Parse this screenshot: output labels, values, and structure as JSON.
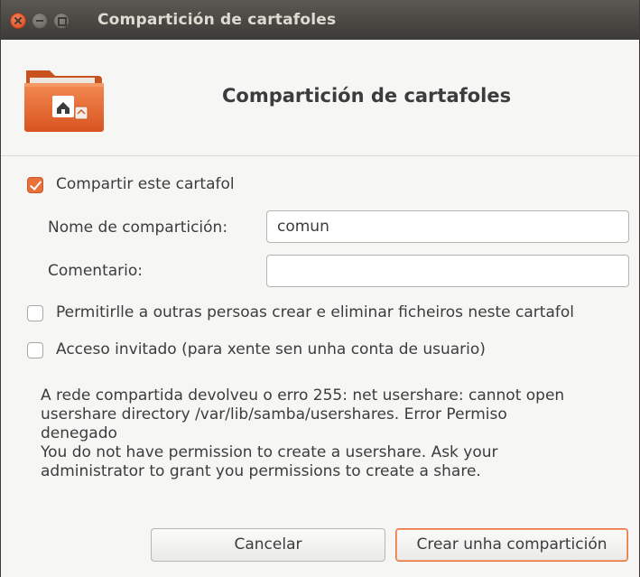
{
  "window": {
    "title": "Compartición de cartafoles"
  },
  "header": {
    "title": "Compartición de cartafoles",
    "icon": "shared-folder-icon"
  },
  "share_checkbox": {
    "label": "Compartir este cartafol",
    "checked": true
  },
  "fields": {
    "share_name_label": "Nome de compartición:",
    "share_name_value": "comun",
    "comment_label": "Comentario:",
    "comment_value": ""
  },
  "options": {
    "allow_others_label": "Permitirlle a outras persoas crear e eliminar ficheiros neste cartafol",
    "allow_others_checked": false,
    "guest_access_label": "Acceso invitado (para xente sen unha conta de usuario)",
    "guest_access_checked": false
  },
  "message": {
    "lines": [
      "A rede compartida devolveu o erro 255: net usershare: cannot open",
      "usershare directory /var/lib/samba/usershares. Error Permiso",
      "denegado",
      "You do not have permission to create a usershare. Ask your",
      "administrator to grant you permissions to create a share."
    ]
  },
  "buttons": {
    "cancel": "Cancelar",
    "create": "Crear unha compartición"
  },
  "colors": {
    "accent": "#e9703b",
    "titlebar": "#3c3b37"
  }
}
